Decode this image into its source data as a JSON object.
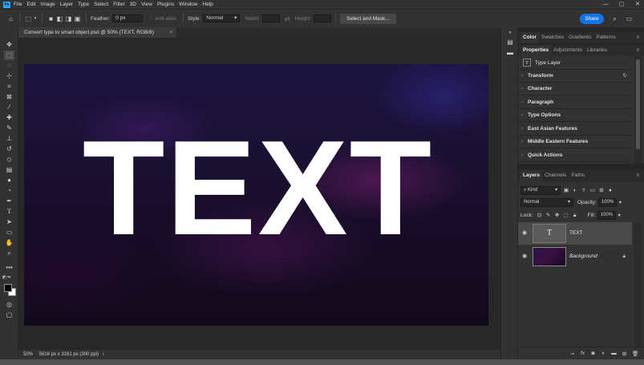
{
  "menubar": {
    "logo": "Ps",
    "items": [
      "File",
      "Edit",
      "Image",
      "Layer",
      "Type",
      "Select",
      "Filter",
      "3D",
      "View",
      "Plugins",
      "Window",
      "Help"
    ]
  },
  "window_controls": {
    "minimize": "—",
    "maximize": "▢",
    "close": "✕"
  },
  "options": {
    "feather_label": "Feather:",
    "feather_value": "0 px",
    "antialias_label": "Anti-alias",
    "style_label": "Style:",
    "style_value": "Normal",
    "width_label": "Width:",
    "height_label": "Height:",
    "select_mask": "Select and Mask...",
    "share": "Share"
  },
  "document": {
    "tab_title": "Convert type to smart object.psd @ 50% (TEXT, RGB/8)",
    "tab_close": "×",
    "canvas_text": "TEXT",
    "zoom": "50%",
    "dimensions": "5616 px x 3161 px (300 ppi)"
  },
  "panels": {
    "top_tabs": [
      "Color",
      "Swatches",
      "Gradients",
      "Patterns"
    ],
    "prop_tabs": [
      "Properties",
      "Adjustments",
      "Libraries"
    ],
    "type_layer_label": "Type Layer",
    "sections": [
      "Transform",
      "Character",
      "Paragraph",
      "Type Options",
      "East Asian Features",
      "Middle Eastern Features",
      "Quick Actions"
    ],
    "layers_tabs": [
      "Layers",
      "Channels",
      "Paths"
    ],
    "filter_kind": "Kind",
    "blend_mode": "Normal",
    "opacity_label": "Opacity:",
    "opacity_value": "100%",
    "lock_label": "Lock:",
    "fill_label": "Fill:",
    "fill_value": "100%",
    "layers": [
      {
        "name": "TEXT",
        "thumb": "T"
      },
      {
        "name": "Background"
      }
    ]
  }
}
